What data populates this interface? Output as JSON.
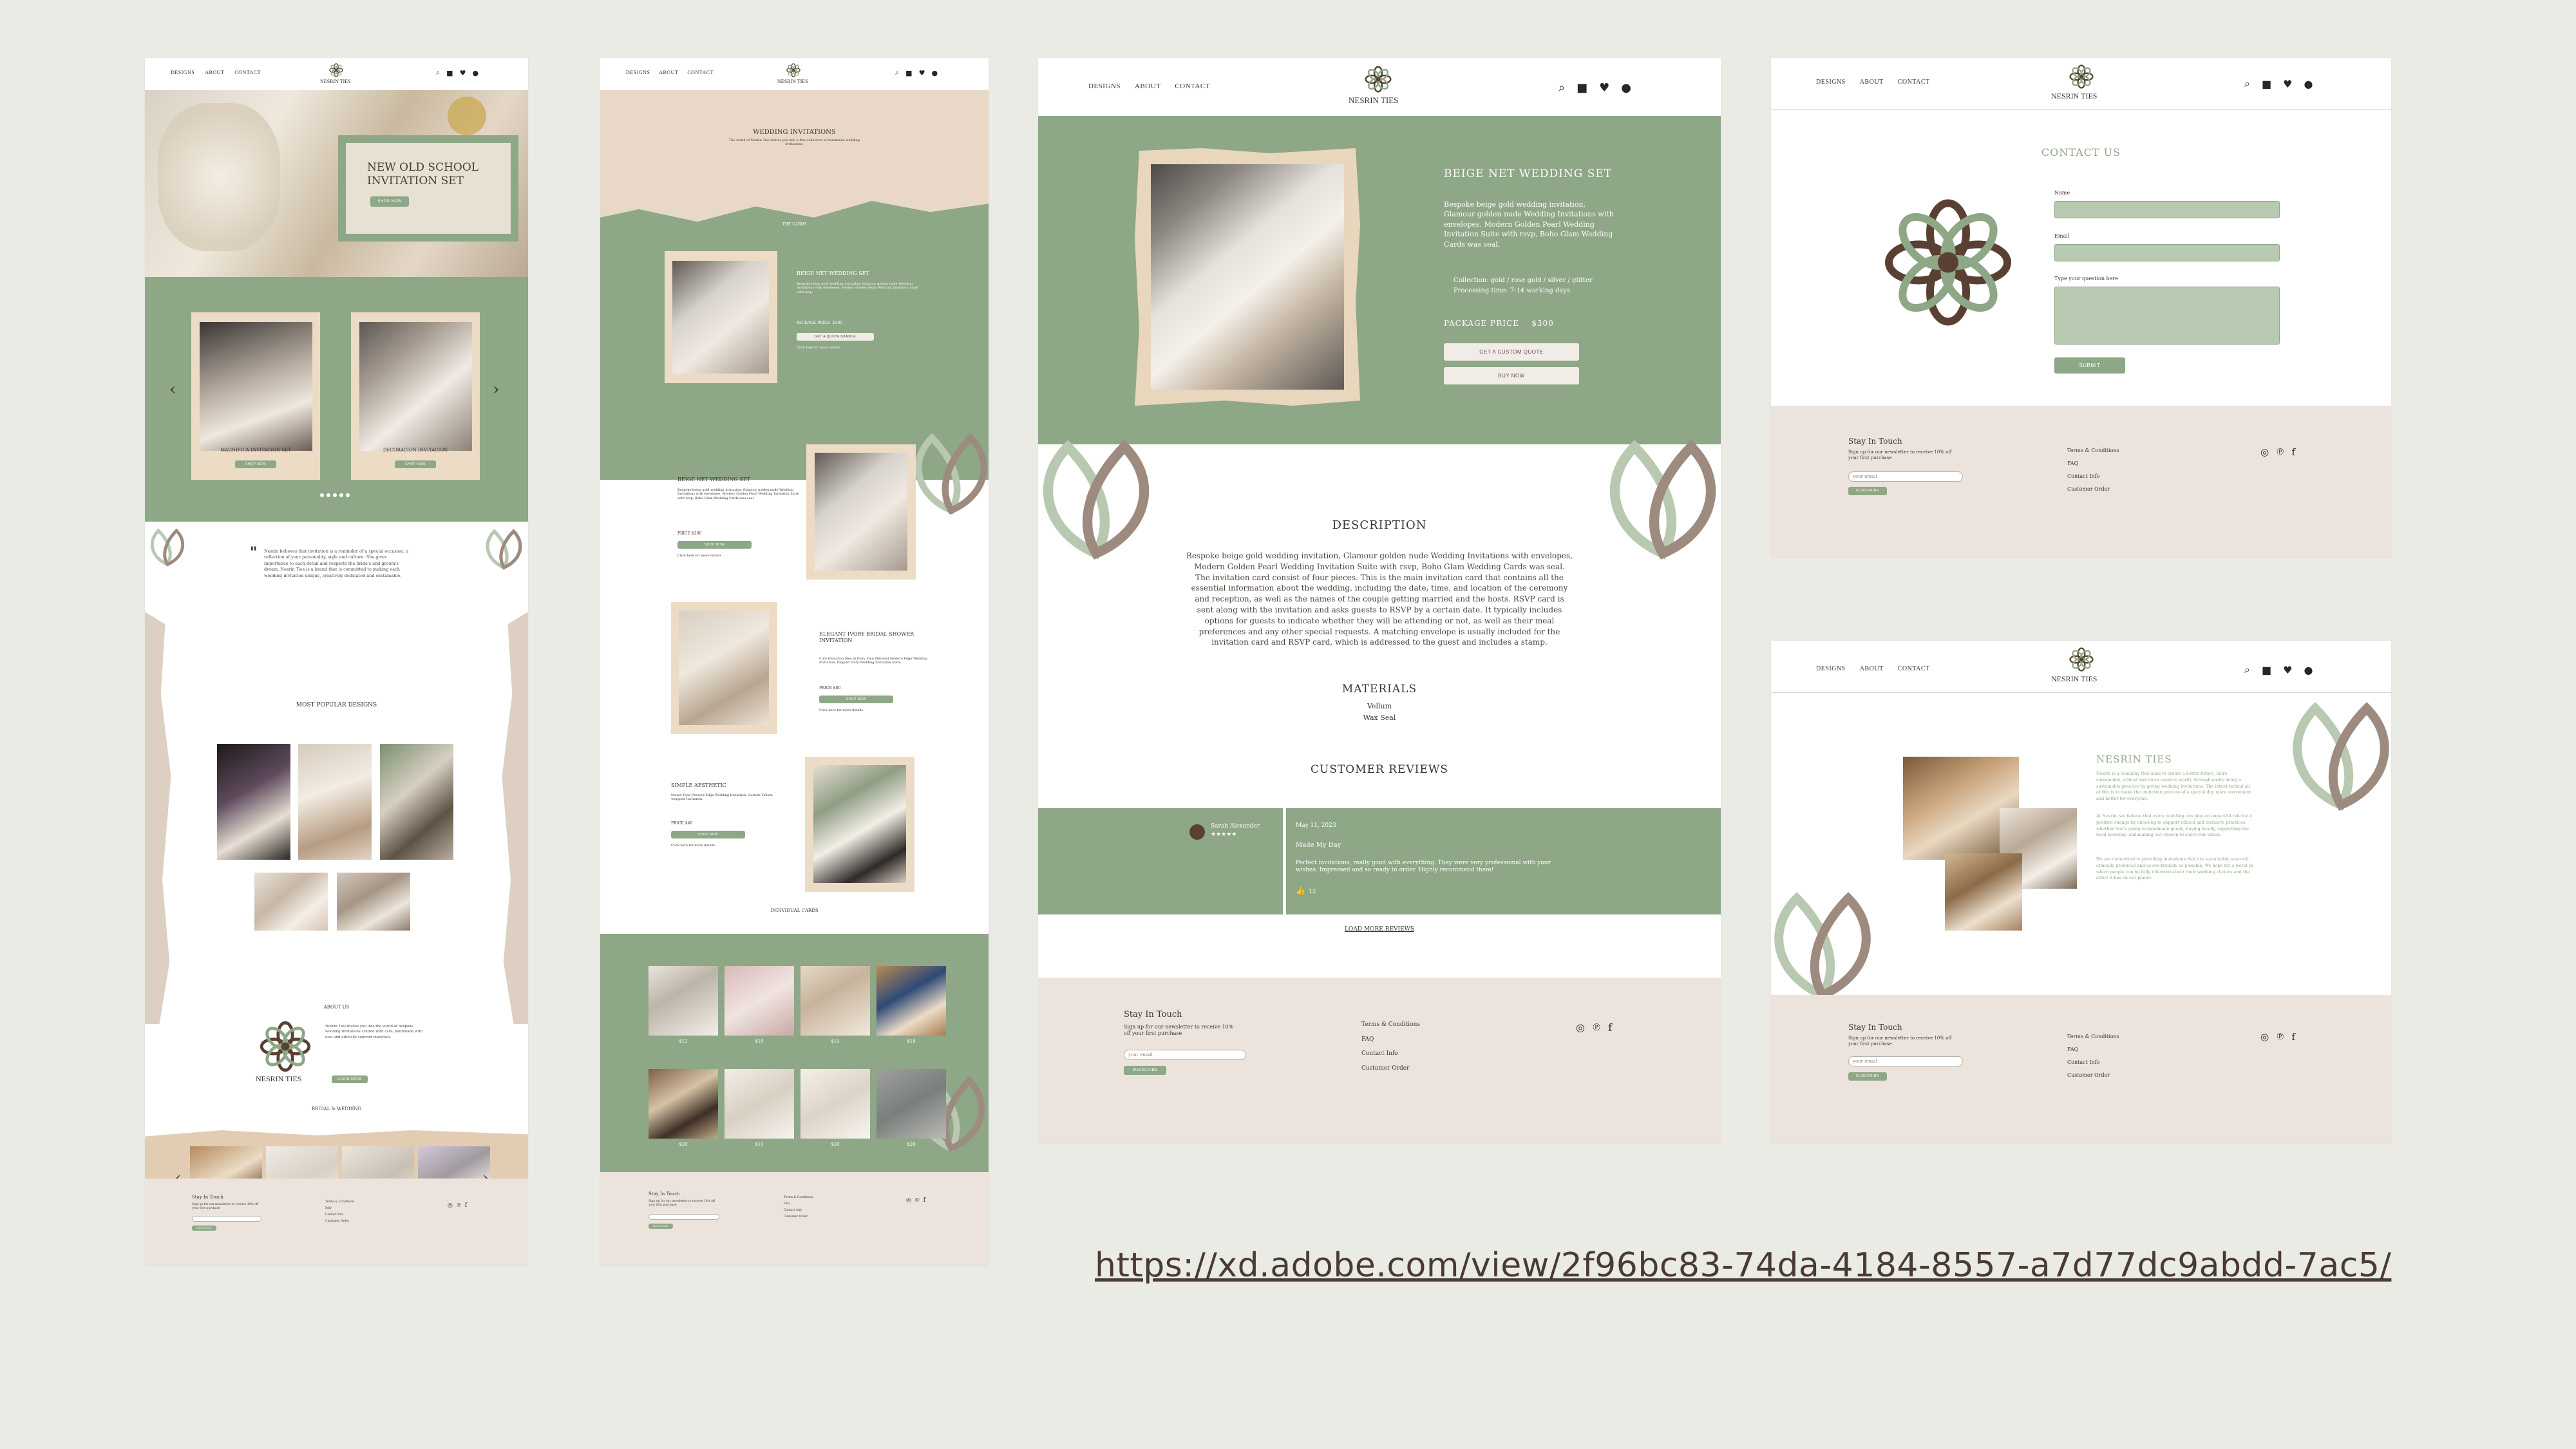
{
  "brand": {
    "name": "NESRIN TIES",
    "logo": "flower-logo"
  },
  "nav": {
    "designs": "DESIGNS",
    "about": "ABOUT",
    "contact": "CONTACT"
  },
  "icons": [
    "search-icon",
    "bag-icon",
    "heart-icon",
    "user-icon"
  ],
  "home": {
    "hero_title": "NEW OLD SCHOOL INVITATION SET",
    "hero_button": "SHOP NOW",
    "slider": [
      {
        "label": "MAGNIFICA INVITACION SET"
      },
      {
        "label": "DECORACION INVITACION"
      }
    ],
    "slider_buttons": [
      "SHOP NOW",
      "SHOP NOW"
    ],
    "quote": "Nesrin believes that invitation is a reminder of a special occasion, a reflection of your personality, style and culture. She gives importance to each detail and respects the bride's and groom's dream. Nesrin Ties is a brand that is committed to making each wedding invitation unique, creatively dedicated and sustainable.",
    "most_popular": "MOST POPULAR DESIGNS",
    "about_title": "ABOUT US",
    "about_text": "Nesrin Ties invites you into the world of bespoke wedding invitations crafted with care, handmade with love and ethically sourced materials.",
    "about_button": "LEARN MORE",
    "bridal_title": "BRIDAL & WEDDING"
  },
  "designs": {
    "header": "WEDDING INVITATIONS",
    "header_sub": "The world of Nesrin Ties invites you into a fine collection of handmade wedding invitations.",
    "section_label": "THE CARDS",
    "featured": {
      "title": "BEIGE NET WEDDING SET",
      "desc": "Bespoke beige gold wedding invitation, Glamour golden nude Wedding Invitations with envelopes, Modern Golden Pearl Wedding Invitation Suite with rsvp.",
      "price_label": "PACKAGE PRICE",
      "price": "$300",
      "button": "GET A QUOTE/SAMPLE",
      "link": "Click here for more details"
    },
    "list": [
      {
        "title": "BEIGE NET WEDDING SET",
        "desc": "Bespoke beige gold wedding invitation, Glamour golden nude Wedding Invitations with envelopes, Modern Golden Pearl Wedding Invitation Suite with rsvp, Boho Glam Wedding Cards was seal.",
        "price": "PRICE   $300",
        "button": "SHOP NOW",
        "link": "Click here for more details"
      },
      {
        "title": "ELEGANT IVORY BRIDAL SHOWER INVITATION",
        "desc": "Cute Invitation Idea in Ivory tone Elevated Modern Edge Wedding Invitation, Elegant Ivory Wedding Invitation Suite.",
        "price": "PRICE   $80",
        "button": "SHOP NOW",
        "link": "Click here for more details"
      },
      {
        "title": "SIMPLE AESTHETIC",
        "desc": "Muted Tone Pressed Edge Wedding Invitation, Custom Vellum wrapped Invitation.",
        "price": "PRICE   $40",
        "button": "SHOP NOW",
        "link": "Click here for more details"
      }
    ],
    "individual": "INDIVIDUAL CARDS",
    "cards": [
      "$12",
      "$10",
      "$15",
      "$18",
      "$20",
      "$15",
      "$20",
      "$20"
    ]
  },
  "product": {
    "title": "BEIGE NET WEDDING SET",
    "desc": "Bespoke beige gold wedding invitation, Glamour golden nude Wedding Invitations with envelopes, Modern Golden Pearl Wedding Invitation Suite with rsvp, Boho Glam Wedding Cards was seal.",
    "collection": "Collection: gold / rose gold / silver / glitter",
    "processing": "Processing time: 7-14 working days",
    "price_label": "PACKAGE PRICE",
    "price": "$300",
    "quote_button": "GET A CUSTOM QUOTE",
    "buy_button": "BUY NOW",
    "description_title": "DESCRIPTION",
    "description": "Bespoke beige gold wedding invitation, Glamour golden nude Wedding Invitations with envelopes, Modern Golden Pearl Wedding Invitation Suite with rsvp, Boho Glam Wedding Cards was seal. The invitation card consist of four pieces. This is the main invitation card that contains all the essential information about the wedding, including the date, time, and location of the ceremony and reception, as well as the names of the couple getting married and the hosts. RSVP card is sent along with the invitation and asks guests to RSVP by a certain date. It typically includes options for guests to indicate whether they will be attending or not, as well as their meal preferences and any other special requests. A matching envelope is usually included for the invitation card and RSVP card, which is addressed to the guest and includes a stamp.",
    "materials_title": "MATERIALS",
    "materials": [
      "Vellum",
      "Wax Seal"
    ],
    "reviews_title": "CUSTOMER REVIEWS",
    "review": {
      "name": "Sarah Alexander",
      "stars": "★★★★★",
      "date": "May 11, 2023",
      "headline": "Made My Day",
      "text": "Perfect invitations, really good with everything. They were very professional with your wishes. Impressed and so ready to order. Highly recommend them!",
      "likes": "12"
    },
    "load_more": "LOAD MORE REVIEWS"
  },
  "contact": {
    "title": "CONTACT US",
    "name_label": "Name",
    "email_label": "Email",
    "question_label": "Type your question here",
    "submit": "SUBMIT"
  },
  "about": {
    "title": "NESRIN TIES",
    "p1": "Nesrin is a company that aims to create a better future, more sustainable, ethical and more creative world, through easily doing a sustainable practice by giving wedding invitations. The intent behind all of this is to make the invitation process of a special day more convenient and better for everyone.",
    "p2": "At Nesrin, we believe that every wedding can play an impactful role for a positive change by choosing to support ethical and inclusive practices, whether that's going to handmade goods, buying locally, supporting the local economy, and making our chosen to share this vision.",
    "p3": "We are committed to providing invitations that are sustainably sourced, ethically produced and as eco-friendly as possible. We hope for a world in which people can be fully informed about their wedding choices and the affect it has on our planet."
  },
  "footer": {
    "stay_title": "Stay In Touch",
    "stay_text": "Sign up for our newsletter to receive 10% off your first purchase",
    "email_placeholder": "your email",
    "subscribe": "SUBSCRIBE",
    "links": [
      "Terms & Conditions",
      "FAQ",
      "Contact Info",
      "Customer Order"
    ],
    "social": [
      "instagram-icon",
      "pinterest-icon",
      "facebook-icon"
    ]
  },
  "xd_link": "https://xd.adobe.com/view/2f96bc83-74da-4184-8557-a7d77dc9abdd-7ac5/",
  "colors": {
    "sage": "#8ea786",
    "beige": "#ece4dc",
    "paper": "#ecdcc6",
    "brown": "#5a4033",
    "bg": "#ebebe6"
  }
}
